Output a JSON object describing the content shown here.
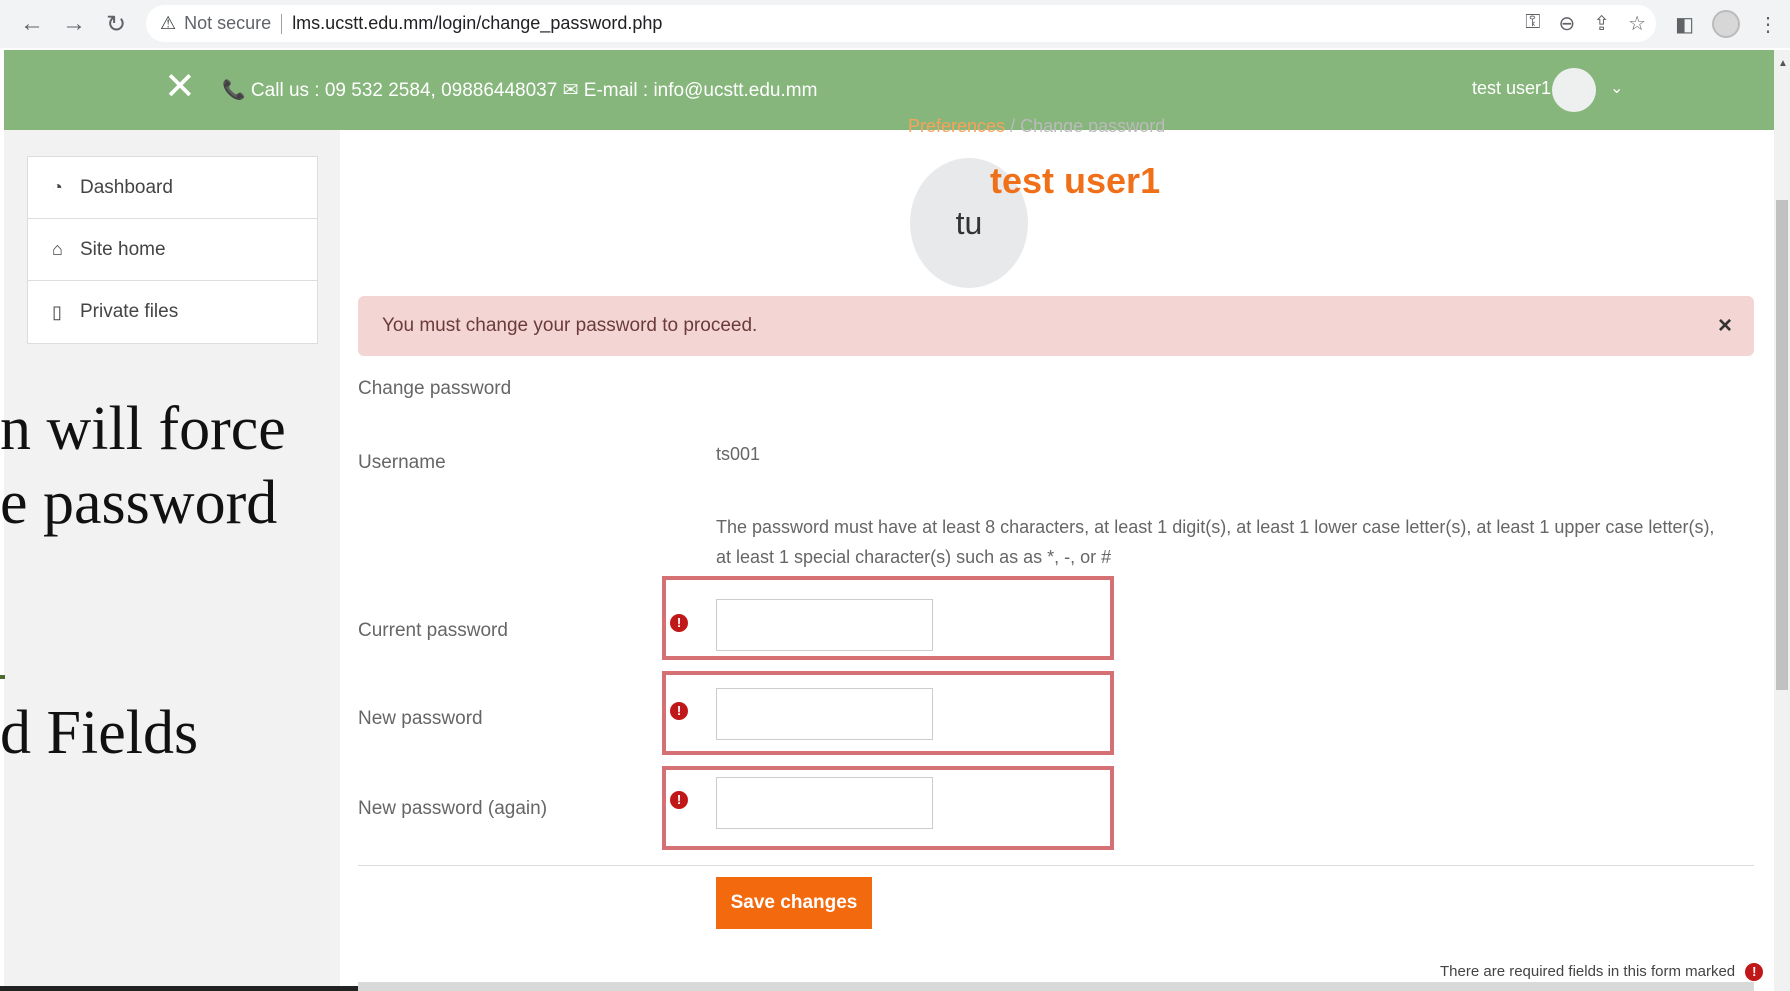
{
  "browser": {
    "security_label": "Not secure",
    "url": "lms.ucstt.edu.mm/login/change_password.php"
  },
  "header": {
    "contact": "📞 Call us : 09 532 2584, 09886448037 ✉ E-mail : info@ucstt.edu.mm",
    "user_name": "test user1"
  },
  "sidebar": {
    "items": [
      {
        "label": "Dashboard",
        "icon": "dashboard-icon"
      },
      {
        "label": "Site home",
        "icon": "home-icon"
      },
      {
        "label": "Private files",
        "icon": "file-icon"
      }
    ]
  },
  "slide_overlay": {
    "line1": "n will force",
    "line2": "e password",
    "line3": "d Fields"
  },
  "breadcrumb": {
    "item1": "Preferences",
    "separator": "/",
    "item2": "Change password"
  },
  "profile": {
    "initials": "tu",
    "name": "test user1"
  },
  "alert": {
    "message": "You must change your password to proceed.",
    "close": "×"
  },
  "form": {
    "section_title": "Change password",
    "username_label": "Username",
    "username_value": "ts001",
    "rules": "The password must have at least 8 characters, at least 1 digit(s), at least 1 lower case letter(s), at least 1 upper case letter(s), at least 1 special character(s) such as as *, -, or #",
    "current_password_label": "Current password",
    "new_password_label": "New password",
    "new_password_again_label": "New password (again)",
    "save_label": "Save changes",
    "required_note": "There are required fields in this form marked"
  },
  "colors": {
    "header_green": "#86b67b",
    "accent_orange": "#f3690e",
    "alert_bg": "#f3d5d4",
    "highlight_frame": "#d57175",
    "required_red": "#c01818"
  }
}
